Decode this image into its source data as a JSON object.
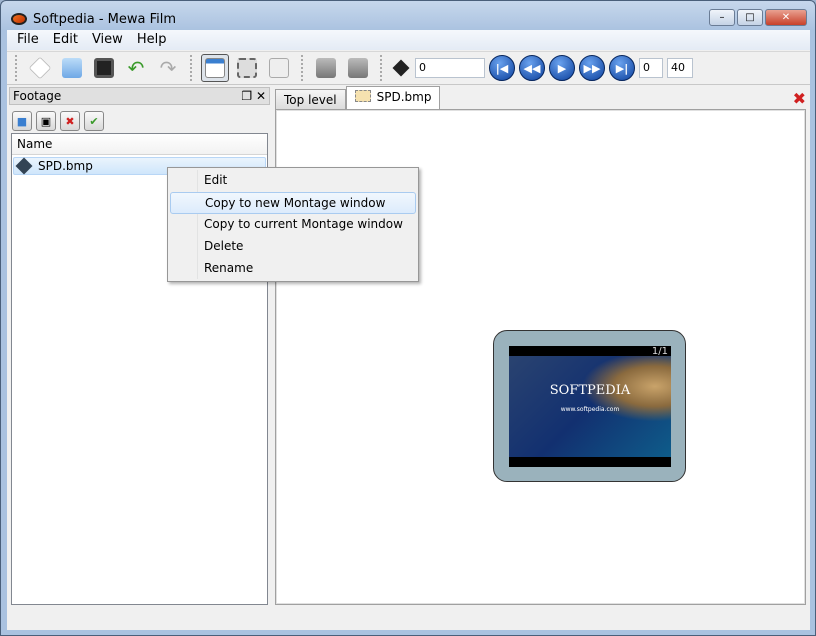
{
  "window": {
    "title": "Softpedia - Mewa Film",
    "minimize": "–",
    "maximize": "□",
    "close": "✕"
  },
  "menu": [
    "File",
    "Edit",
    "View",
    "Help"
  ],
  "toolbar": {
    "frame_value": "0",
    "range_start": "0",
    "range_end": "40"
  },
  "footage": {
    "title": "Footage",
    "float": "❐",
    "close": "✕",
    "column": "Name",
    "items": [
      "SPD.bmp"
    ]
  },
  "tabs": [
    "Top level",
    "SPD.bmp"
  ],
  "montage": {
    "counter": "1/1",
    "image_title": "SOFTPEDIA",
    "image_url": "www.softpedia.com"
  },
  "context_menu": [
    "Edit",
    "Copy to new Montage window",
    "Copy to current Montage window",
    "Delete",
    "Rename"
  ]
}
